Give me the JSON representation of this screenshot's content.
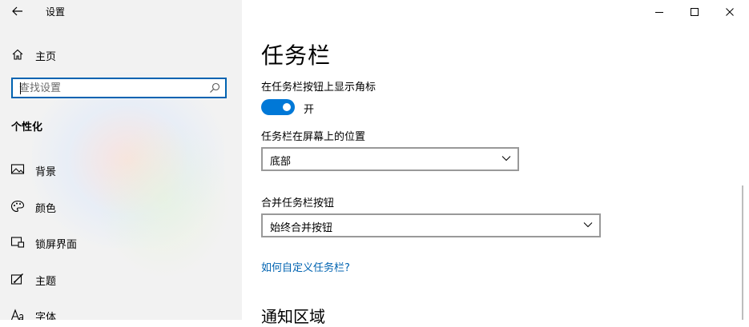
{
  "window": {
    "title": "设置",
    "controls": {
      "minimize": "minimize",
      "maximize": "maximize",
      "close": "close"
    }
  },
  "sidebar": {
    "home_label": "主页",
    "search": {
      "placeholder": "查找设置",
      "value": ""
    },
    "section_title": "个性化",
    "items": [
      {
        "label": "背景",
        "icon": "picture-icon"
      },
      {
        "label": "颜色",
        "icon": "palette-icon"
      },
      {
        "label": "锁屏界面",
        "icon": "lock-screen-icon"
      },
      {
        "label": "主题",
        "icon": "theme-icon"
      },
      {
        "label": "字体",
        "icon": "font-icon"
      }
    ]
  },
  "main": {
    "title": "任务栏",
    "show_badges": {
      "label": "在任务栏按钮上显示角标",
      "state": "开",
      "on": true
    },
    "position": {
      "label": "任务栏在屏幕上的位置",
      "value": "底部"
    },
    "combine": {
      "label": "合并任务栏按钮",
      "value": "始终合并按钮"
    },
    "help_link": "如何自定义任务栏?",
    "next_section": "通知区域"
  },
  "colors": {
    "accent": "#0078d7",
    "link": "#0063b1",
    "sidebar_bg": "#f2f2f2"
  }
}
